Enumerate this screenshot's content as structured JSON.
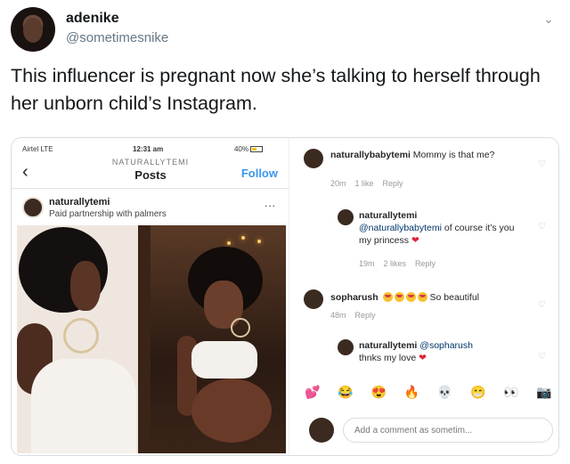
{
  "tweet": {
    "display_name": "adenike",
    "handle": "@sometimesnike",
    "text": "This influencer is pregnant now she’s talking to herself through her unborn child’s Instagram."
  },
  "instagram": {
    "status_bar": {
      "carrier": "Airtel LTE",
      "time": "12:31 am",
      "battery": "40%"
    },
    "profile_username": "NATURALLYTEMI",
    "header_title": "Posts",
    "follow_label": "Follow",
    "post": {
      "username": "naturallytemi",
      "subtitle": "Paid partnership with palmers",
      "more": "..."
    },
    "comments": [
      {
        "user": "naturallybabytemi",
        "text": "Mommy is that me?",
        "time": "20m",
        "likes": "1 like",
        "reply": "Reply"
      },
      {
        "user": "naturallytemi",
        "mention": "@naturallybabytemi",
        "text": "of course it’s you my princess",
        "time": "19m",
        "likes": "2 likes",
        "reply": "Reply"
      },
      {
        "user": "sopharush",
        "text": "So beautiful",
        "time": "48m",
        "reply": "Reply"
      },
      {
        "user": "naturallytemi",
        "mention": "@sopharush",
        "text": "thnks my love",
        "time": "",
        "reply": ""
      }
    ],
    "emoji_bar": [
      "💕",
      "😂",
      "😍",
      "🔥",
      "💀",
      "😁",
      "👀",
      "📷"
    ],
    "comment_placeholder": "Add a comment as sometim..."
  },
  "colors": {
    "twitter_text": "#14171a",
    "twitter_secondary": "#657786",
    "instagram_blue": "#3897f0",
    "heart_red": "#e0243b"
  }
}
